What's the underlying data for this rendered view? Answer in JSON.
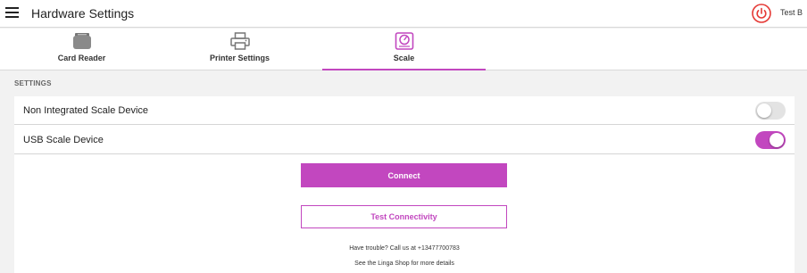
{
  "header": {
    "title": "Hardware Settings",
    "user": "Test B",
    "menu_icon": "hamburger-menu-icon",
    "power_icon": "power-icon",
    "accent": "#e53935"
  },
  "tabs": [
    {
      "label": "Card Reader",
      "icon": "card-reader-icon",
      "active": false
    },
    {
      "label": "Printer Settings",
      "icon": "printer-icon",
      "active": false
    },
    {
      "label": "Scale",
      "icon": "scale-icon",
      "active": true
    }
  ],
  "settings": {
    "section_label": "SETTINGS",
    "rows": [
      {
        "label": "Non Integrated Scale Device",
        "enabled": false
      },
      {
        "label": "USB Scale Device",
        "enabled": true
      }
    ]
  },
  "actions": {
    "connect_label": "Connect",
    "test_label": "Test Connectivity"
  },
  "help": {
    "line1": "Have trouble? Call us at +13477700783",
    "line2": "See the Linga Shop for more details"
  },
  "colors": {
    "accent": "#c247bf",
    "toggle_off": "#e3e3e3",
    "background": "#f2f2f2"
  }
}
